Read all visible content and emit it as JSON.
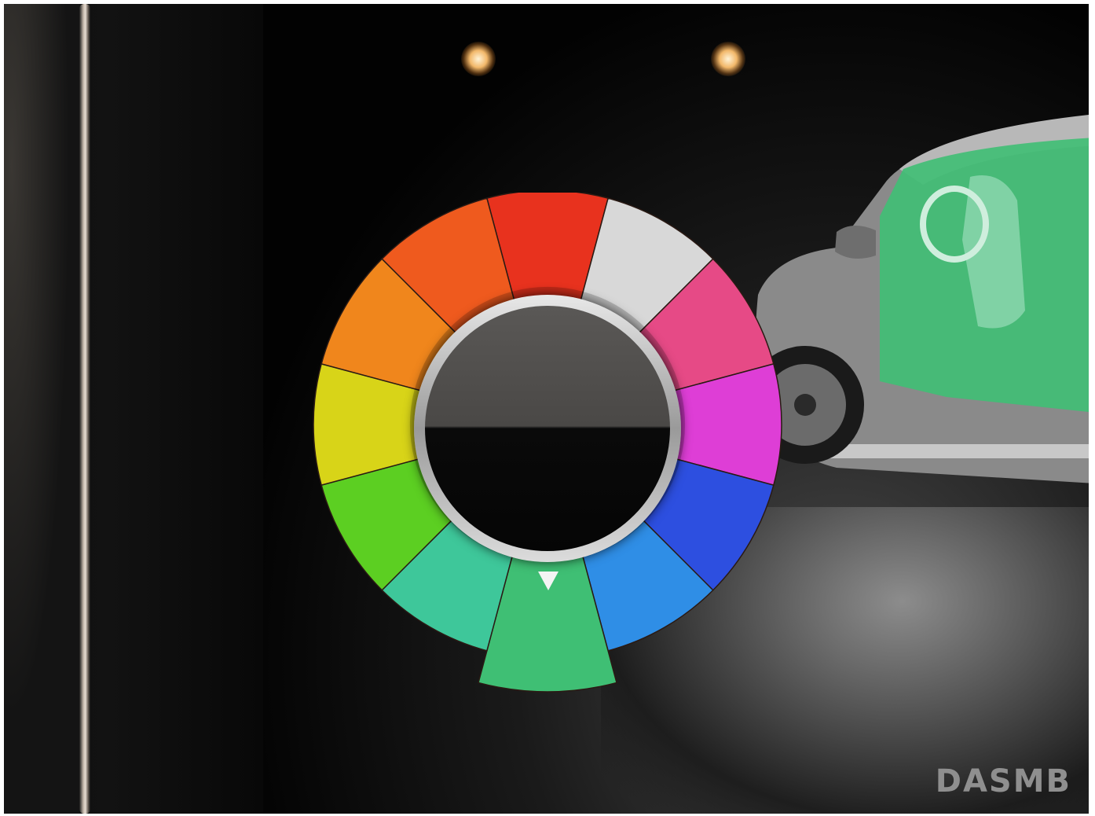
{
  "color_wheel": {
    "segments": [
      {
        "name": "red",
        "color": "#e8321e"
      },
      {
        "name": "white",
        "color": "#d8d8d8"
      },
      {
        "name": "pink",
        "color": "#e64a86"
      },
      {
        "name": "magenta",
        "color": "#de3ed6"
      },
      {
        "name": "blue",
        "color": "#2d4fe0"
      },
      {
        "name": "light-blue",
        "color": "#2f8ee6"
      },
      {
        "name": "green",
        "color": "#3fbf74"
      },
      {
        "name": "teal",
        "color": "#3ec79a"
      },
      {
        "name": "lime-green",
        "color": "#5ccf22"
      },
      {
        "name": "yellow",
        "color": "#d8d418"
      },
      {
        "name": "orange",
        "color": "#f0861c"
      },
      {
        "name": "orange-red",
        "color": "#ef5a1e"
      }
    ],
    "selected": "green",
    "selected_color": "#3fbf74"
  },
  "vehicle": {
    "interior_light_color": "#3fbf74",
    "body_color": "#8a8a8a"
  },
  "watermark": "DASMB"
}
